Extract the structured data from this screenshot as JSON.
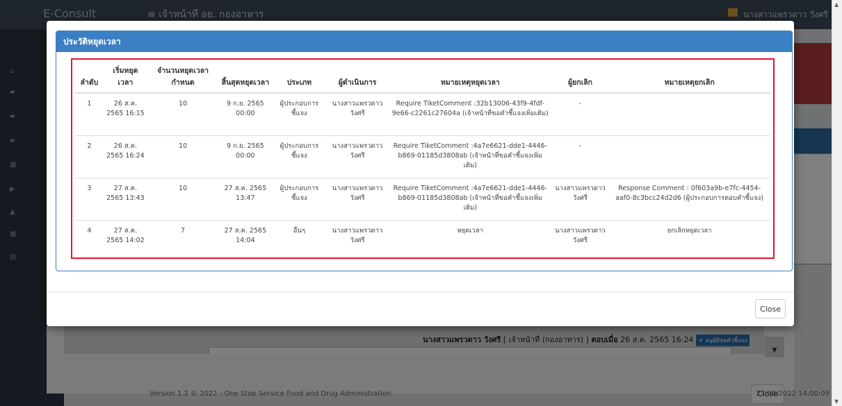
{
  "background": {
    "brand": "E-Consult",
    "menu_title": "เจ้าหน้าที่ อย. กองอาหาร",
    "user": "นางสาวแพรวดาว วังศรี",
    "answer_name": "นางสาวแพรวดาว วังศรี",
    "answer_role": "[ เจ้าหน้าที่ (กองอาหาร) ]",
    "answer_when_label": "ตอบเมื่อ",
    "answer_when": "26 ส.ค. 2565 16:24",
    "answer_badge": "✔ อนุมัติขอคำชี้แจง",
    "close_label": "Close",
    "footer": "Version 1.2 © 2022 - One Stop Service Food and Drug Administration",
    "footer_right": "27/08/2022 14:00:09"
  },
  "modal": {
    "title": "ประวัติหยุดเวลา",
    "close_label": "Close",
    "columns": [
      "ลำดับ",
      "เริ่มหยุดเวลา",
      "จำนวนหยุดเวลากำหนด",
      "สิ้นสุดหยุดเวลา",
      "ประเภท",
      "ผู้ดำเนินการ",
      "หมายเหตุหยุดเวลา",
      "ผู้ยกเลิก",
      "หมายเหตุยกเลิก"
    ],
    "rows": [
      {
        "no": "1",
        "start": "26 ส.ค. 2565 16:15",
        "days": "10",
        "end": "9 ก.ย. 2565 00:00",
        "type": "ผู้ประกอบการชี้แจง",
        "operator": "นางสาวแพรวดาว วังศรี",
        "note": "Require TiketComment :32b13006-43f9-4fdf-9e66-c2261c27604a (เจ้าหน้าที่ขอคำชี้แจงเพิ่มเติม)",
        "canceller": "-",
        "cancel_note": ""
      },
      {
        "no": "2",
        "start": "26 ส.ค. 2565 16:24",
        "days": "10",
        "end": "9 ก.ย. 2565 00:00",
        "type": "ผู้ประกอบการชี้แจง",
        "operator": "นางสาวแพรวดาว วังศรี",
        "note": "Require TiketComment :4a7e6621-dde1-4446-b869-01185d3808ab (เจ้าหน้าที่ขอคำชี้แจงเพิ่มเติม)",
        "canceller": "-",
        "cancel_note": ""
      },
      {
        "no": "3",
        "start": "27 ส.ค. 2565 13:43",
        "days": "10",
        "end": "27 ส.ค. 2565 13:47",
        "type": "ผู้ประกอบการชี้แจง",
        "operator": "นางสาวแพรวดาว วังศรี",
        "note": "Require TiketComment :4a7e6621-dde1-4446-b869-01185d3808ab (เจ้าหน้าที่ขอคำชี้แจงเพิ่มเติม)",
        "canceller": "นางสาวแพรวดาว วังศรี",
        "cancel_note": "Response Comment : 0f603a9b-e7fc-4454-aaf0-8c3bcc24d2d6 (ผู้ประกอบการตอบคำชี้แจง)"
      },
      {
        "no": "4",
        "start": "27 ส.ค. 2565 14:02",
        "days": "7",
        "end": "27 ส.ค. 2565 14:04",
        "type": "อื่นๆ",
        "operator": "นางสาวแพรวดาว วังศรี",
        "note": "หยุดเวลา",
        "canceller": "นางสาวแพรวดาว วังศรี",
        "cancel_note": "ยกเลิกหยุดเวลา"
      }
    ]
  },
  "colors": {
    "panel_blue": "#3b7fc4",
    "highlight_red": "#e2152b"
  }
}
